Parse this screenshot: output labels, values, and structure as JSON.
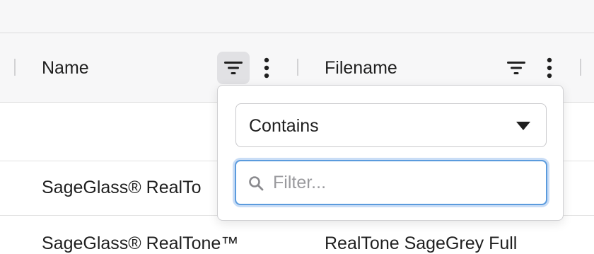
{
  "grid": {
    "columns": [
      {
        "id": "name",
        "label": "Name",
        "filter_icon": "filter-lines-icon",
        "menu_icon": "vertical-dots-icon",
        "filter_active": true
      },
      {
        "id": "filename",
        "label": "Filename",
        "filter_icon": "filter-lines-icon",
        "menu_icon": "vertical-dots-icon",
        "filter_active": false
      }
    ],
    "rows": [
      {
        "name": "",
        "filename": ""
      },
      {
        "name": "SageGlass® RealTo",
        "filename": ""
      },
      {
        "name": "SageGlass® RealTone™",
        "filename": "RealTone SageGrey Full"
      }
    ]
  },
  "filter_popup": {
    "operator": {
      "selected": "Contains",
      "caret_icon": "caret-down-icon"
    },
    "input": {
      "value": "",
      "placeholder": "Filter...",
      "icon": "search-icon"
    }
  },
  "colors": {
    "header_bg": "#f7f7f8",
    "active_button_bg": "#e1e1e4",
    "focus_border": "#5b9bdd",
    "focus_ring": "#c9ddf6",
    "text": "#1f1f1f",
    "placeholder": "#9a9a9e"
  }
}
